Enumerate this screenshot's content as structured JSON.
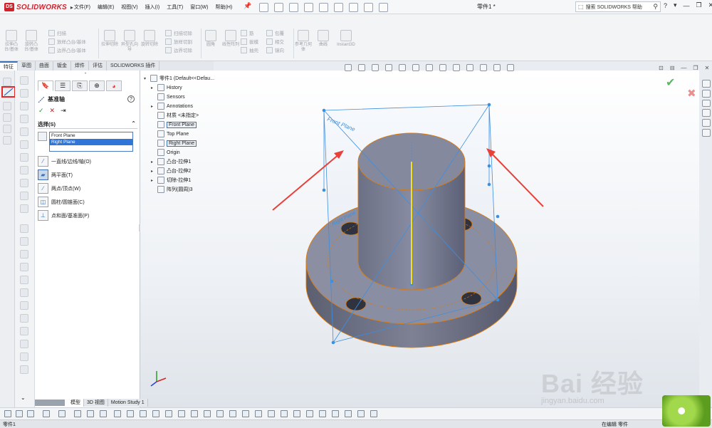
{
  "app": {
    "logo_prefix": "DS",
    "logo_text": "SOLIDWORKS",
    "doc_title": "零件1 *",
    "search_placeholder": "搜索 SOLIDWORKS 帮助",
    "window_controls": [
      "?",
      "▾",
      "—",
      "❐",
      "✕"
    ]
  },
  "menu": [
    "文件(F)",
    "编辑(E)",
    "视图(V)",
    "插入(I)",
    "工具(T)",
    "窗口(W)",
    "帮助(H)"
  ],
  "commands": {
    "big": [
      {
        "label": "拉伸凸台/基体"
      },
      {
        "label": "旋转凸台/基体"
      },
      {
        "label": "拉伸切除"
      },
      {
        "label": "异型孔向导"
      },
      {
        "label": "旋转切除"
      }
    ],
    "rows1": [
      "扫描",
      "放样凸台/基体",
      "边界凸台/基体"
    ],
    "rows2": [
      "扫描切除",
      "放样切割",
      "边界切除"
    ],
    "mid": [
      {
        "label": "圆角"
      },
      {
        "label": "线性阵列"
      }
    ],
    "rows3": [
      "筋",
      "拔模",
      "抽壳"
    ],
    "rows4": [
      "包覆",
      "相交",
      "镜向"
    ],
    "right": [
      {
        "label": "参考几何体"
      },
      {
        "label": "曲线"
      },
      {
        "label": "Instant3D"
      }
    ]
  },
  "tabs": [
    "特征",
    "草图",
    "曲面",
    "钣金",
    "焊件",
    "评估",
    "SOLIDWORKS 插件"
  ],
  "property_manager": {
    "title": "基准轴",
    "help": "?",
    "ok": "✓",
    "cancel": "✕",
    "pin": "⇥",
    "section": "选择(S)",
    "selections": [
      "Front Plane",
      "Right Plane"
    ],
    "options": [
      "一直线/边线/轴(O)",
      "两平面(T)",
      "两点/顶点(W)",
      "圆柱/圆锥面(C)",
      "点和面/基准面(P)"
    ],
    "active_option_index": 1
  },
  "tree": {
    "root": "零件1 (Default<<Defau...",
    "items": [
      "History",
      "Sensors",
      "Annotations",
      "材质 <未指定>",
      "Front Plane",
      "Top Plane",
      "Right Plane",
      "Origin",
      "凸台-拉伸1",
      "凸台-拉伸2",
      "切除-拉伸1",
      "阵列(圆周)3"
    ]
  },
  "model_labels": {
    "front_plane": "Front Plane",
    "right_plane": "Right Plane"
  },
  "bottom_tabs": [
    "模型",
    "3D 视图",
    "Motion Study 1"
  ],
  "status": {
    "left": "零件1",
    "right": "在编辑 零件"
  },
  "watermark": {
    "main": "Bai 经验",
    "sub": "jingyan.baidu.com"
  },
  "colors": {
    "accent": "#3b6fb6",
    "ok": "#1c9a28",
    "cancel": "#c81e1e",
    "edge": "#e07a0a",
    "model": "#7a7d8e",
    "plane": "#3d8fe0",
    "arrow": "#e8403a"
  }
}
